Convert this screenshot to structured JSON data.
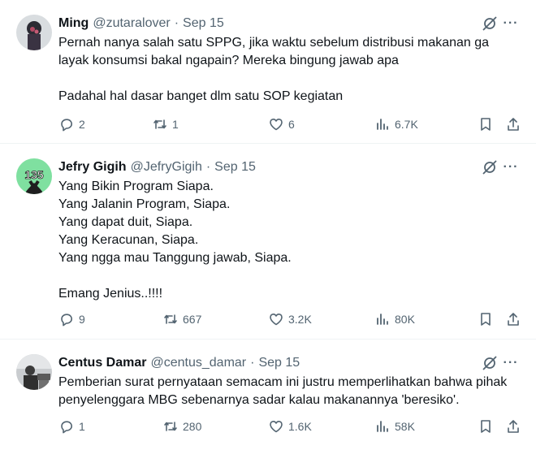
{
  "tweets": [
    {
      "name": "Ming",
      "handle": "@zutaralover",
      "date": "Sep 15",
      "text": "Pernah nanya salah satu SPPG, jika waktu sebelum distribusi makanan ga layak konsumsi bakal ngapain? Mereka bingung jawab apa\n\nPadahal hal dasar banget dlm satu SOP kegiatan",
      "replies": "2",
      "reposts": "1",
      "likes": "6",
      "views": "6.7K"
    },
    {
      "name": "Jefry Gigih",
      "handle": "@JefryGigih",
      "date": "Sep 15",
      "text": "Yang Bikin Program Siapa.\nYang Jalanin Program, Siapa.\nYang dapat duit, Siapa.\nYang Keracunan, Siapa.\nYang ngga mau Tanggung jawab, Siapa.\n\nEmang Jenius..!!!!",
      "avatar_text": "135",
      "replies": "9",
      "reposts": "667",
      "likes": "3.2K",
      "views": "80K"
    },
    {
      "name": "Centus Damar",
      "handle": "@centus_damar",
      "date": "Sep 15",
      "text": "Pemberian surat pernyataan semacam ini justru memperlihatkan bahwa pihak penyelenggara MBG sebenarnya sadar kalau makanannya 'beresiko'.",
      "replies": "1",
      "reposts": "280",
      "likes": "1.6K",
      "views": "58K"
    }
  ],
  "more_glyph": "···",
  "colors": {
    "text": "#0f1419",
    "secondary": "#536471",
    "divider": "#eff3f4",
    "avatar_green": "#7fe0a0"
  },
  "icons": [
    "reply-icon",
    "repost-icon",
    "like-icon",
    "views-icon",
    "bookmark-icon",
    "share-icon",
    "grok-icon",
    "more-icon"
  ]
}
